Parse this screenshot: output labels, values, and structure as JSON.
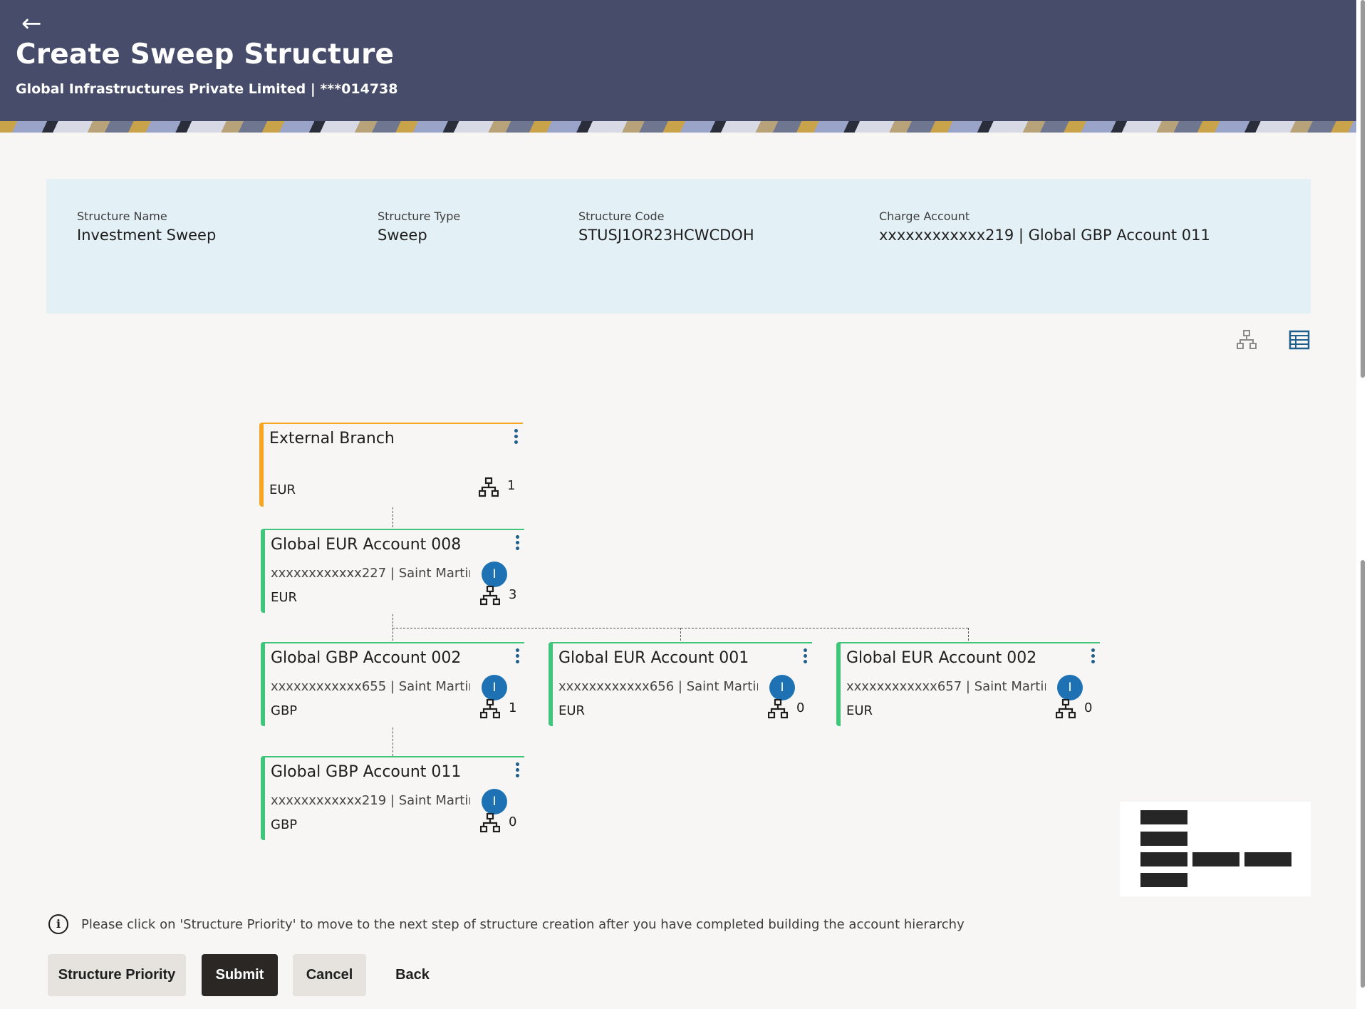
{
  "header": {
    "back_icon": "arrow-left-icon",
    "title": "Create Sweep Structure",
    "subtitle": "Global Infrastructures Private Limited | ***014738"
  },
  "summary": {
    "structure_name_label": "Structure Name",
    "structure_name": "Investment Sweep",
    "structure_type_label": "Structure Type",
    "structure_type": "Sweep",
    "structure_code_label": "Structure Code",
    "structure_code": "STUSJ1OR23HCWCDOH",
    "charge_account_label": "Charge Account",
    "charge_account": "xxxxxxxxxxxx219 | Global GBP Account 011"
  },
  "views": {
    "tree_view_icon": "hierarchy-icon",
    "table_view_icon": "table-icon"
  },
  "tree": {
    "root": {
      "title": "External Branch",
      "currency": "EUR",
      "children_count": "1"
    },
    "level1": {
      "title": "Global EUR Account 008",
      "account": "xxxxxxxxxxxx227 | Saint Martin...",
      "badge": "I",
      "currency": "EUR",
      "children_count": "3"
    },
    "level2": [
      {
        "title": "Global GBP Account 002",
        "account": "xxxxxxxxxxxx655 | Saint Martin...",
        "badge": "I",
        "currency": "GBP",
        "children_count": "1"
      },
      {
        "title": "Global EUR Account 001",
        "account": "xxxxxxxxxxxx656 | Saint Martin...",
        "badge": "I",
        "currency": "EUR",
        "children_count": "0"
      },
      {
        "title": "Global EUR Account 002",
        "account": "xxxxxxxxxxxx657 | Saint Martin...",
        "badge": "I",
        "currency": "EUR",
        "children_count": "0"
      }
    ],
    "level3": {
      "title": "Global GBP Account 011",
      "account": "xxxxxxxxxxxx219 | Saint Martin...",
      "badge": "I",
      "currency": "GBP",
      "children_count": "0"
    }
  },
  "info": {
    "icon": "info-icon",
    "message": "Please click on 'Structure Priority' to move to the next step of structure creation after you have completed building the account hierarchy"
  },
  "actions": {
    "structure_priority": "Structure Priority",
    "submit": "Submit",
    "cancel": "Cancel",
    "back": "Back"
  },
  "colors": {
    "header_bg": "#464c69",
    "panel_bg": "#e3f0f6",
    "root_accent": "#f6a623",
    "node_accent": "#3fc67a",
    "badge": "#1e72b4",
    "primary_button": "#2b2724"
  }
}
